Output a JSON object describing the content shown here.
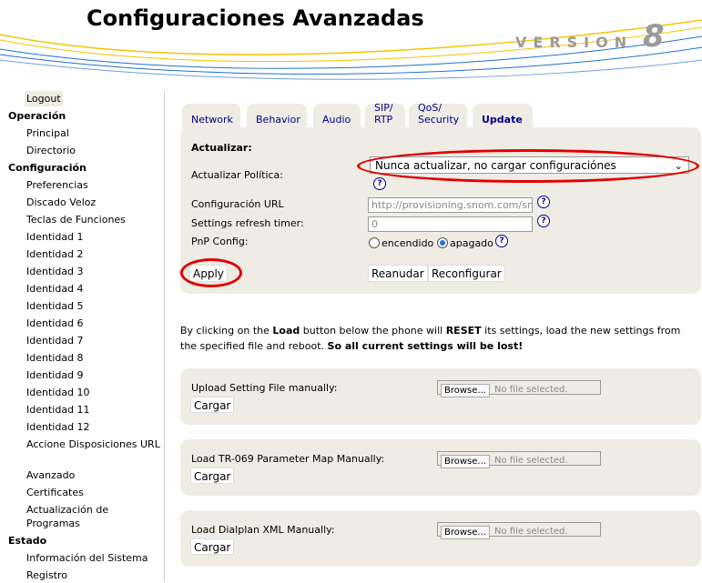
{
  "header": {
    "title": "Configuraciones Avanzadas",
    "version_label": "VERSION",
    "version_number": "8"
  },
  "sidebar": {
    "logout": "Logout",
    "operacion": {
      "title": "Operación",
      "items": [
        "Principal",
        "Directorio"
      ]
    },
    "configuracion": {
      "title": "Configuración",
      "items": [
        "Preferencias",
        "Discado Veloz",
        "Teclas de Funciones",
        "Identidad 1",
        "Identidad 2",
        "Identidad 3",
        "Identidad 4",
        "Identidad 5",
        "Identidad 6",
        "Identidad 7",
        "Identidad 8",
        "Identidad 9",
        "Identidad 10",
        "Identidad 11",
        "Identidad 12",
        "Accione Disposiciones URL",
        "Avanzado",
        "Certificates",
        "Actualización de Programas"
      ]
    },
    "estado": {
      "title": "Estado",
      "items": [
        "Información del Sistema",
        "Registro"
      ]
    }
  },
  "tabs": [
    {
      "label": "Network"
    },
    {
      "label": "Behavior"
    },
    {
      "label": "Audio"
    },
    {
      "label": "SIP/ RTP"
    },
    {
      "label": "QoS/ Security"
    },
    {
      "label": "Update",
      "active": true
    }
  ],
  "update_form": {
    "section_title": "Actualizar:",
    "policy_label": "Actualizar Política:",
    "policy_value": "Nunca actualizar, no cargar configuraciónes",
    "url_label": "Configuración URL",
    "url_value": "http://provisioning.snom.com/snom",
    "refresh_label": "Settings refresh timer:",
    "refresh_value": "0",
    "pnp_label": "PnP Config:",
    "pnp_on": "encendido",
    "pnp_off": "apagado",
    "pnp_selected": "apagado",
    "apply": "Apply",
    "reset": "Reanudar",
    "reconfigure": "Reconfigurar",
    "help": "?"
  },
  "load_note": {
    "p1": "By clicking on the ",
    "b1": "Load",
    "p2": " button below the phone will ",
    "b2": "RESET",
    "p3": " its settings, load the new settings from the specified file and reboot. ",
    "b3": "So all current settings will be lost!"
  },
  "uploads": [
    {
      "label": "Upload Setting File manually:",
      "button": "Cargar",
      "browse": "Browse...",
      "no_file": "No file selected."
    },
    {
      "label": "Load TR-069 Parameter Map Manually:",
      "button": "Cargar",
      "browse": "Browse...",
      "no_file": "No file selected."
    },
    {
      "label": "Load Dialplan XML Manually:",
      "button": "Cargar",
      "browse": "Browse...",
      "no_file": "No file selected."
    }
  ],
  "colors": {
    "panel": "#eeece4",
    "link": "#00008b",
    "highlight": "#e00000"
  }
}
